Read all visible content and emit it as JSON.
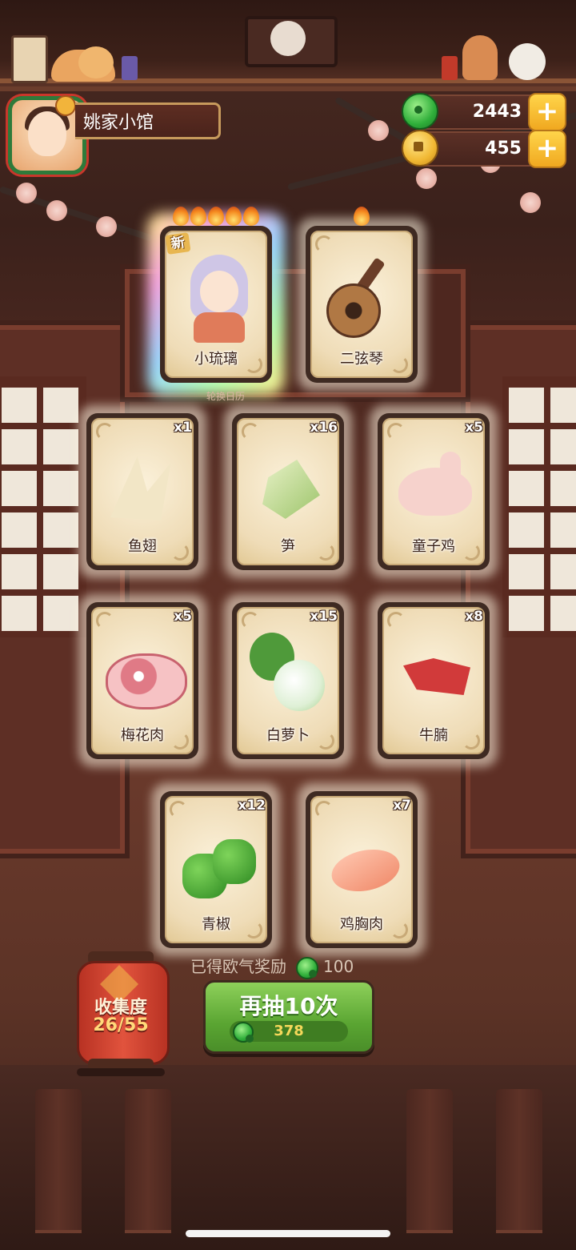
{
  "header": {
    "shop_name": "姚家小馆",
    "jade_amount": "2443",
    "coin_amount": "455",
    "plus_label": "+"
  },
  "gacha": {
    "featured": [
      {
        "name": "小琉璃",
        "tag": "新",
        "flames": 5,
        "rarity": "rainbow"
      },
      {
        "name": "二弦琴",
        "flames": 1
      }
    ],
    "featured_caption": "轮换日历",
    "items": [
      {
        "name": "鱼翅",
        "count": "x1",
        "icon": "shark-fin-icon"
      },
      {
        "name": "笋",
        "count": "x16",
        "icon": "bamboo-shoot-icon"
      },
      {
        "name": "童子鸡",
        "count": "x5",
        "icon": "chicken-icon"
      },
      {
        "name": "梅花肉",
        "count": "x5",
        "icon": "pork-icon"
      },
      {
        "name": "白萝卜",
        "count": "x15",
        "icon": "radish-icon"
      },
      {
        "name": "牛腩",
        "count": "x8",
        "icon": "beef-icon"
      },
      {
        "name": "青椒",
        "count": "x12",
        "icon": "green-pepper-icon"
      },
      {
        "name": "鸡胸肉",
        "count": "x7",
        "icon": "chicken-breast-icon"
      }
    ]
  },
  "footer": {
    "collection_label": "收集度",
    "collection_value": "26/55",
    "reward_label": "已得欧气奖励",
    "reward_amount": "100",
    "redraw_label": "再抽10次",
    "redraw_cost": "378"
  },
  "colors": {
    "jade": "#2fae3a",
    "gold": "#f0a820",
    "redraw_green": "#5aa532",
    "lantern_red": "#e1533d"
  }
}
